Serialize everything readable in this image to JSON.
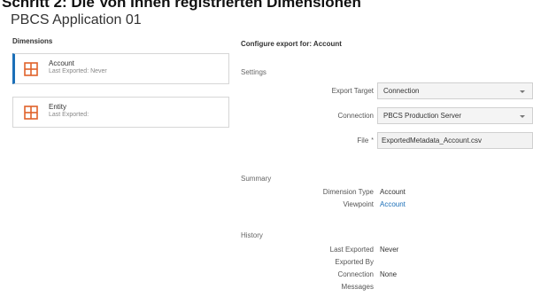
{
  "page_heading": "Schritt 2: Die Von Ihnen registrierten Dimensionen",
  "app_title": "PBCS Application 01",
  "left": {
    "label": "Dimensions",
    "items": [
      {
        "name": "Account",
        "status": "Last Exported: Never"
      },
      {
        "name": "Entity",
        "status": "Last Exported:"
      }
    ]
  },
  "right": {
    "config_title": "Configure export for: Account",
    "settings": {
      "title": "Settings",
      "export_target_label": "Export Target",
      "export_target_value": "Connection",
      "connection_label": "Connection",
      "connection_value": "PBCS Production Server",
      "file_label": "File",
      "file_required": "*",
      "file_value": "ExportedMetadata_Account.csv"
    },
    "summary": {
      "title": "Summary",
      "dimension_type_label": "Dimension Type",
      "dimension_type_value": "Account",
      "viewpoint_label": "Viewpoint",
      "viewpoint_value": "Account"
    },
    "history": {
      "title": "History",
      "last_exported_label": "Last Exported",
      "last_exported_value": "Never",
      "exported_by_label": "Exported By",
      "connection_label": "Connection",
      "connection_value": "None",
      "messages_label": "Messages"
    }
  },
  "colors": {
    "accent": "#1b6fb8",
    "icon": "#e0622a"
  }
}
